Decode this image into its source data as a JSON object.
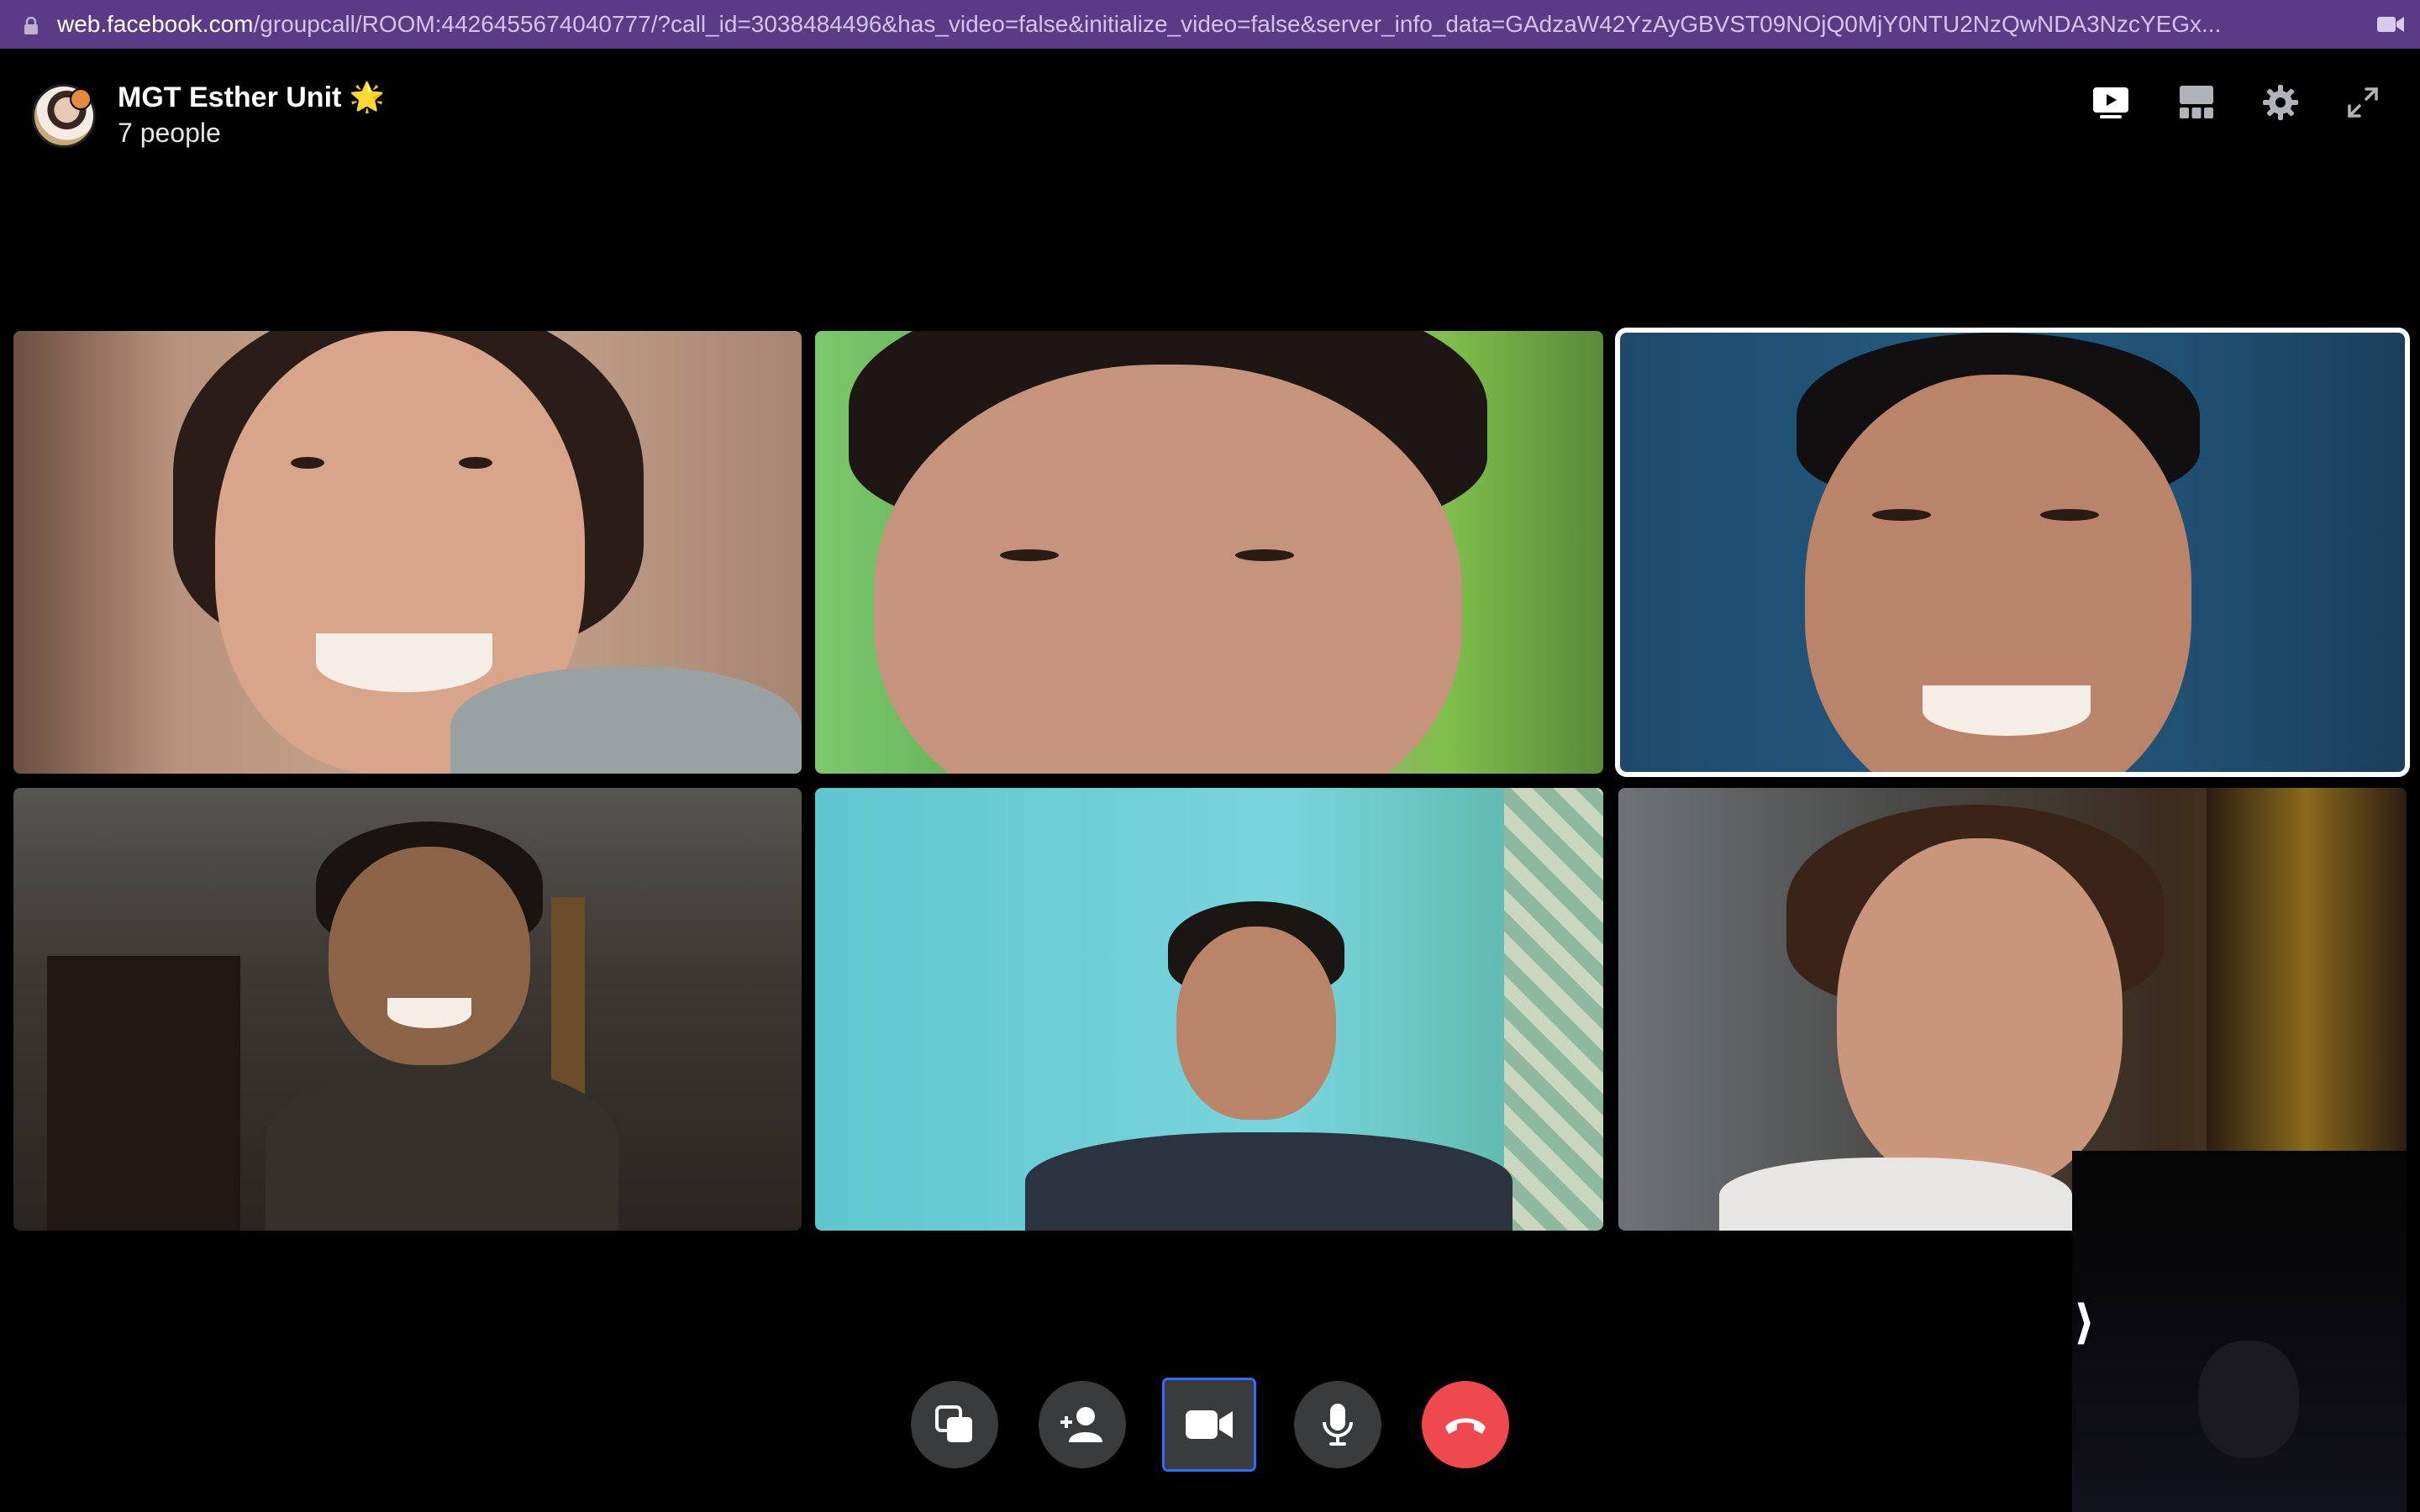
{
  "browser": {
    "url_domain": "web.facebook.com",
    "url_path": "/groupcall/ROOM:4426455674040777/?call_id=3038484496&has_video=false&initialize_video=false&server_info_data=GAdzaW42YzAyGBVST09NOjQ0MjY0NTU2NzQwNDA3NzcYEGx..."
  },
  "call": {
    "group_name": "MGT Esther Unit 🌟",
    "participant_count": "7 people"
  },
  "header_icons": [
    "screen-share-view-icon",
    "grid-layout-icon",
    "settings-icon",
    "fullscreen-icon"
  ],
  "controls": [
    "share-screen-icon",
    "add-person-icon",
    "video-camera-icon",
    "microphone-icon",
    "end-call-icon"
  ],
  "self_view": {
    "collapse_glyph": "⟩"
  },
  "colors": {
    "url_bar": "#5b3a86",
    "hangup": "#f0484f",
    "control_bg": "#3a3b3c",
    "active_speaker_border": "#ffffff"
  }
}
